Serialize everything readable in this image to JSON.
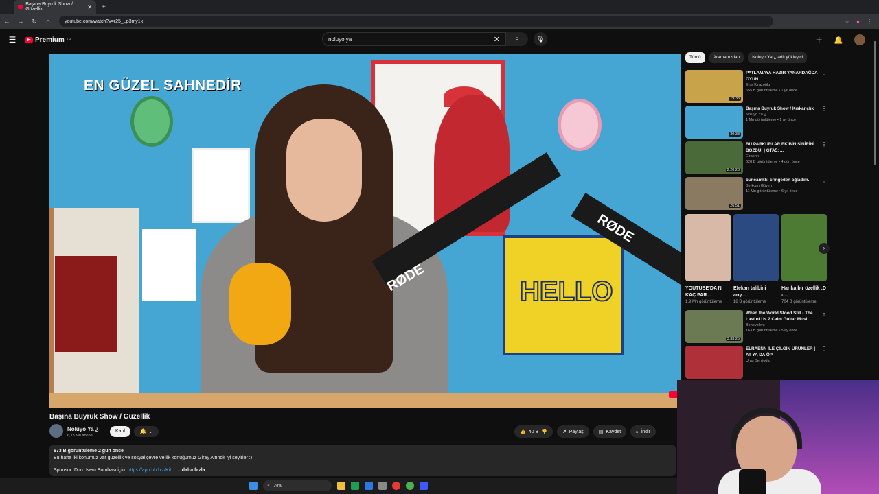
{
  "browser": {
    "tab_title": "Başına Buyruk Show / Güzellik",
    "url": "youtube.com/watch?v=r25_Lp3my1k"
  },
  "header": {
    "logo_text": "Premium",
    "logo_sup": "TR",
    "search_value": "noluyo ya"
  },
  "video": {
    "overlay_title": "EN GÜZEL SAHNEDİR",
    "title": "Başına Buyruk Show / Güzellik",
    "channel": "Noluyo Ya ¿",
    "subscribers": "6,13 Mn abone",
    "join_label": "Katıl",
    "likes": "40 B",
    "share_label": "Paylaş",
    "save_label": "Kaydet",
    "download_label": "İndir",
    "hello_text": "HELLO",
    "brand_text": "RØDE"
  },
  "description": {
    "stats": "673 B görüntüleme  2 gün önce",
    "line1": "Bu hafta iki konumuz var güzellik ve sosyal çevre ve ilk konuğumuz Giray Altınok iyi seyirler :)",
    "sponsor_prefix": "Sponsor: Duru Nem Bombası için: ",
    "sponsor_link": "https://app.hb.biz/KiL...",
    "more": "...daha fazla"
  },
  "sidebar": {
    "chips": [
      "Tümü",
      "Aramanızdan",
      "Noluyo Ya ¿ adlı yükleyici"
    ],
    "recs": [
      {
        "title": "PATLAMAYA HAZIR YANARDAĞDA OYUN ...",
        "channel": "Enis Kirazoğlu",
        "meta": "655 B görüntüleme • 1 yıl önce",
        "dur": "19:33",
        "color": "#c9a34a"
      },
      {
        "title": "Başına Buyruk Show / Kıskançlık",
        "channel": "Noluyo Ya ¿",
        "meta": "1 Mn görüntüleme • 1 ay önce",
        "dur": "30:33",
        "color": "#46a5d2"
      },
      {
        "title": "BU PARKURLAR EKİBİN SİNİRİNİ BOZDU! | GTA5: ...",
        "channel": "Elraenn",
        "meta": "628 B görüntüleme • 4 gün önce",
        "dur": "2:20:28",
        "color": "#4b6a3a"
      },
      {
        "title": "buneamk5: cringeden ağladım.",
        "channel": "Berkcan Güven",
        "meta": "11 Mn görüntüleme • 6 yıl önce",
        "dur": "26:51",
        "color": "#8a7a62"
      }
    ],
    "new_badge": "Yeni",
    "shorts": [
      {
        "title": "YOUTUBE'DA N KAÇ PAR...",
        "views": "1,9 Mn görüntüleme",
        "color": "#d8b9a8"
      },
      {
        "title": "Efekan talibini arıy...",
        "views": "18 B görüntüleme",
        "color": "#2c4a82"
      },
      {
        "title": "Harika bir özellik :D - ...",
        "views": "704 B görüntüleme",
        "color": "#4e7b34"
      }
    ],
    "recs2": [
      {
        "title": "When the World Stood Still - The Last of Us 2 Calm Guitar Musi...",
        "channel": "Benevolent",
        "meta": "163 B görüntüleme • 5 ay önce",
        "dur": "3:33:25",
        "color": "#6b7a52"
      },
      {
        "title": "ELRAENN İLE ÇILGIN ÜRÜNLER | AT YA DA ÖP",
        "channel": "Uras Benlioğlu",
        "meta": "",
        "dur": "",
        "color": "#b0303a"
      }
    ]
  },
  "taskbar": {
    "search_label": "Ara"
  }
}
